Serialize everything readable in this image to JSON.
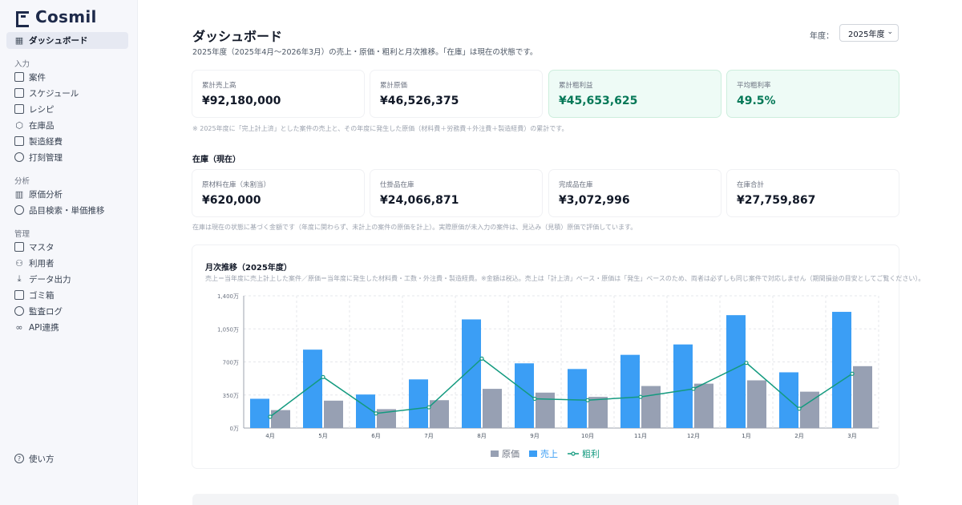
{
  "app": {
    "name": "Cosmil"
  },
  "sidebar": {
    "dashboard": {
      "label": "ダッシュボード"
    },
    "section_input": "入力",
    "input_items": [
      {
        "label": "案件",
        "icon": "clipboard-icon"
      },
      {
        "label": "スケジュール",
        "icon": "calendar-icon"
      },
      {
        "label": "レシピ",
        "icon": "recipe-icon"
      },
      {
        "label": "在庫品",
        "icon": "box-icon"
      },
      {
        "label": "製造経費",
        "icon": "receipt-icon"
      },
      {
        "label": "打刻管理",
        "icon": "clock-icon"
      }
    ],
    "section_analysis": "分析",
    "analysis_items": [
      {
        "label": "原価分析",
        "icon": "bar-chart-icon"
      },
      {
        "label": "品目検索・単価推移",
        "icon": "search-icon"
      }
    ],
    "section_admin": "管理",
    "admin_items": [
      {
        "label": "マスタ",
        "icon": "database-icon"
      },
      {
        "label": "利用者",
        "icon": "user-plus-icon"
      },
      {
        "label": "データ出力",
        "icon": "download-icon"
      },
      {
        "label": "ゴミ箱",
        "icon": "trash-icon"
      },
      {
        "label": "監査ログ",
        "icon": "history-icon"
      },
      {
        "label": "API連携",
        "icon": "link-icon"
      }
    ],
    "help": {
      "label": "使い方",
      "icon": "help-icon"
    }
  },
  "header": {
    "title": "ダッシュボード",
    "subtitle": "2025年度（2025年4月〜2026年3月）の売上・原価・粗利と月次推移。「在庫」は現在の状態です。",
    "year_label": "年度：",
    "year_value": "2025年度"
  },
  "summary_cards": [
    {
      "label": "累計売上高",
      "value": "¥92,180,000"
    },
    {
      "label": "累計原価",
      "value": "¥46,526,375"
    },
    {
      "label": "累計粗利益",
      "value": "¥45,653,625"
    },
    {
      "label": "平均粗利率",
      "value": "49.5%"
    }
  ],
  "summary_note": "※ 2025年度に「完上計上済」とした案件の売上と、その年度に発生した原価（材料費＋労務費＋外注費＋製造経費）の累計です。",
  "inventory": {
    "heading": "在庫（現在）",
    "cards": [
      {
        "label": "原材料在庫（未割当）",
        "value": "¥620,000"
      },
      {
        "label": "仕掛品在庫",
        "value": "¥24,066,871"
      },
      {
        "label": "完成品在庫",
        "value": "¥3,072,996"
      },
      {
        "label": "在庫合計",
        "value": "¥27,759,867"
      }
    ],
    "note": "在庫は現在の状態に基づく金額です（年度に関わらず、未計上の案件の原価を計上）。実際原価が未入力の案件は、見込み（見積）原価で評価しています。"
  },
  "colors": {
    "sales": "#3b9ef5",
    "cost": "#97a0b3",
    "profit": "#139a7f",
    "accent": "#047857"
  },
  "chart": {
    "title": "月次推移（2025年度）",
    "subtitle": "売上＝当年度に売上計上した案件／原価＝当年度に発生した材料費・工数・外注費・製造経費。※金額は税込。売上は「計上済」ベース・原価は「発生」ベースのため、両者は必ずしも同じ案件で対応しません（期間損益の目安としてご覧ください）。"
  },
  "chart_data": {
    "type": "bar",
    "categories": [
      "4月",
      "5月",
      "6月",
      "7月",
      "8月",
      "9月",
      "10月",
      "11月",
      "12月",
      "1月",
      "2月",
      "3月"
    ],
    "y_ticks": [
      "0万",
      "350万",
      "700万",
      "1,050万",
      "1,400万"
    ],
    "ylim": [
      0,
      1400
    ],
    "unit": "万円",
    "series": [
      {
        "name": "売上",
        "type": "bar",
        "values": [
          310,
          830,
          355,
          515,
          1150,
          685,
          625,
          775,
          885,
          1195,
          590,
          1230
        ]
      },
      {
        "name": "原価",
        "type": "bar",
        "values": [
          190,
          290,
          200,
          295,
          415,
          375,
          330,
          445,
          470,
          505,
          385,
          655
        ]
      },
      {
        "name": "粗利",
        "type": "line",
        "values": [
          120,
          540,
          155,
          220,
          735,
          310,
          295,
          330,
          415,
          690,
          205,
          575
        ]
      }
    ],
    "legend": [
      "原価",
      "売上",
      "粗利"
    ],
    "legend_position": "bottom",
    "grid": true
  }
}
